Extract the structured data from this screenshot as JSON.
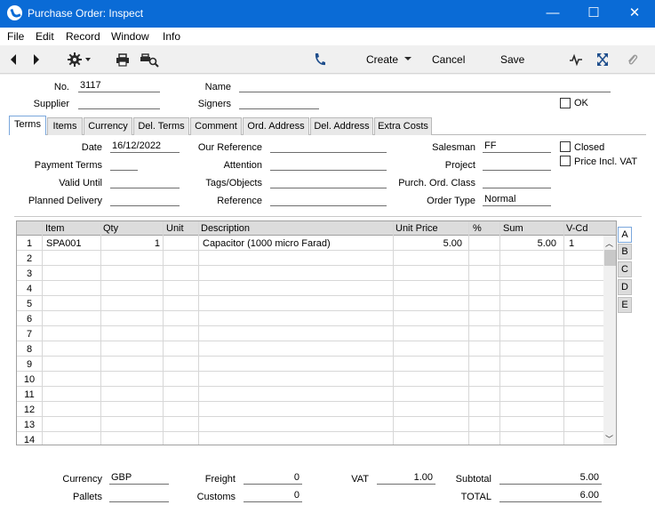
{
  "window": {
    "title": "Purchase Order: Inspect",
    "minimize": "—",
    "maximize": "☐",
    "close": "✕"
  },
  "menu": [
    "File",
    "Edit",
    "Record",
    "Window",
    "Info"
  ],
  "toolbar": {
    "create": "Create",
    "cancel": "Cancel",
    "save": "Save"
  },
  "header": {
    "no_label": "No.",
    "no_value": "3117",
    "name_label": "Name",
    "name_value": "",
    "supplier_label": "Supplier",
    "supplier_value": "",
    "signers_label": "Signers",
    "signers_value": "",
    "ok_label": "OK",
    "ok_checked": false
  },
  "tabs": [
    "Terms",
    "Items",
    "Currency",
    "Del. Terms",
    "Comment",
    "Ord. Address",
    "Del. Address",
    "Extra Costs"
  ],
  "active_tab": "Terms",
  "terms": {
    "date_label": "Date",
    "date_value": "16/12/2022",
    "payment_terms_label": "Payment Terms",
    "payment_terms_value": "",
    "valid_until_label": "Valid Until",
    "valid_until_value": "",
    "planned_delivery_label": "Planned Delivery",
    "planned_delivery_value": "",
    "our_reference_label": "Our Reference",
    "our_reference_value": "",
    "attention_label": "Attention",
    "attention_value": "",
    "tags_label": "Tags/Objects",
    "tags_value": "",
    "reference_label": "Reference",
    "reference_value": "",
    "salesman_label": "Salesman",
    "salesman_value": "FF",
    "project_label": "Project",
    "project_value": "",
    "purch_ord_class_label": "Purch. Ord. Class",
    "purch_ord_class_value": "",
    "order_type_label": "Order Type",
    "order_type_value": "Normal",
    "closed_label": "Closed",
    "closed_checked": false,
    "price_incl_vat_label": "Price Incl. VAT",
    "price_incl_vat_checked": false
  },
  "grid": {
    "columns": [
      "Item",
      "Qty",
      "Unit",
      "Description",
      "Unit Price",
      "%",
      "Sum",
      "V-Cd"
    ],
    "row_numbers": [
      "1",
      "2",
      "3",
      "4",
      "5",
      "6",
      "7",
      "8",
      "9",
      "10",
      "11",
      "12",
      "13",
      "14"
    ],
    "rows": [
      {
        "item": "SPA001",
        "qty": "1",
        "unit": "",
        "description": "Capacitor (1000 micro Farad)",
        "unit_price": "5.00",
        "pct": "",
        "sum": "5.00",
        "vcd": "1"
      }
    ],
    "side_tabs": [
      "A",
      "B",
      "C",
      "D",
      "E"
    ],
    "active_side_tab": "A"
  },
  "footer": {
    "currency_label": "Currency",
    "currency_value": "GBP",
    "pallets_label": "Pallets",
    "pallets_value": "",
    "freight_label": "Freight",
    "freight_value": "0",
    "customs_label": "Customs",
    "customs_value": "0",
    "vat_label": "VAT",
    "vat_value": "1.00",
    "subtotal_label": "Subtotal",
    "subtotal_value": "5.00",
    "total_label": "TOTAL",
    "total_value": "6.00"
  }
}
